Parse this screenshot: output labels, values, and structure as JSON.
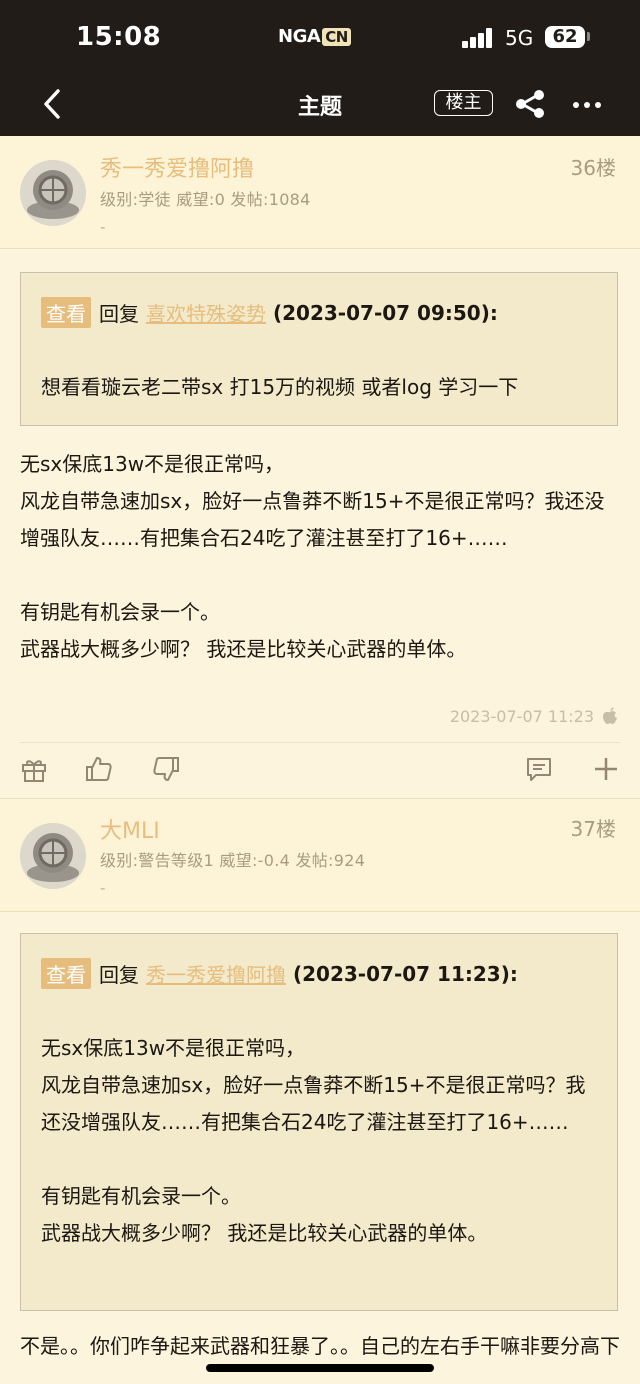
{
  "status_bar": {
    "time": "15:08",
    "brand": "NGA",
    "brand_suffix": "CN",
    "network": "5G",
    "battery": "62"
  },
  "nav": {
    "title": "主题",
    "op_button": "楼主"
  },
  "posts": [
    {
      "username": "秀一秀爱撸阿撸",
      "meta": "级别:学徒   威望:0   发帖:1084",
      "dash": "-",
      "floor": "36楼",
      "quote": {
        "tag": "查看",
        "reply_word": "回复",
        "reply_to": "喜欢特殊姿势",
        "date": "(2023-07-07 09:50):",
        "text": "想看看璇云老二带sx 打15万的视频 或者log 学习一下"
      },
      "body": [
        "无sx保底13w不是很正常吗，",
        "风龙自带急速加sx，脸好一点鲁莽不断15+不是很正常吗？我还没增强队友……有把集合石24吃了灌注甚至打了16+……",
        "",
        "有钥匙有机会录一个。",
        "武器战大概多少啊？ 我还是比较关心武器的单体。"
      ],
      "timestamp": "2023-07-07 11:23"
    },
    {
      "username": "大MLI",
      "meta": "级别:警告等级1   威望:-0.4   发帖:924",
      "dash": "-",
      "floor": "37楼",
      "quote": {
        "tag": "查看",
        "reply_word": "回复",
        "reply_to": "秀一秀爱撸阿撸",
        "date": "(2023-07-07 11:23):",
        "text": [
          "无sx保底13w不是很正常吗，",
          "风龙自带急速加sx，脸好一点鲁莽不断15+不是很正常吗？我还没增强队友……有把集合石24吃了灌注甚至打了16+……",
          "",
          "有钥匙有机会录一个。",
          "武器战大概多少啊？ 我还是比较关心武器的单体。"
        ]
      },
      "body": [
        "不是。。你们咋争起来武器和狂暴了。。自己的左右手干嘛非要分高下"
      ]
    }
  ]
}
